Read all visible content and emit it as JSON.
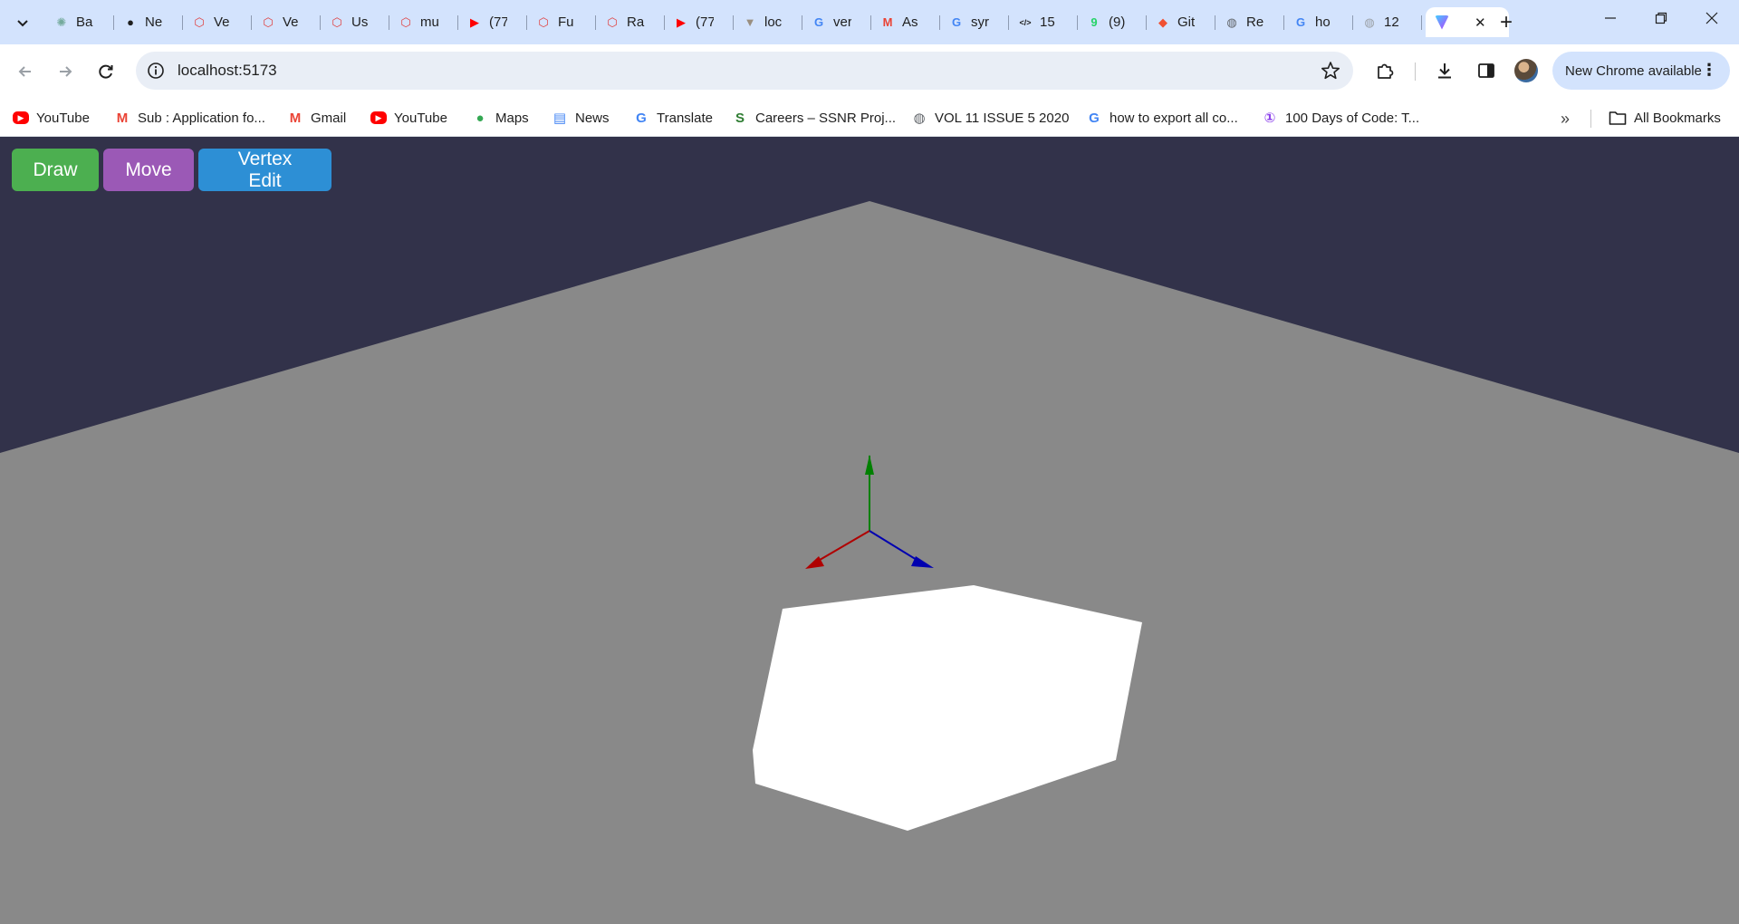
{
  "tabs": [
    {
      "title": "Ba",
      "icon": "chatgpt-icon",
      "color": "#74aa9c"
    },
    {
      "title": "Ne",
      "icon": "github-icon",
      "color": "#1f1f1f"
    },
    {
      "title": "Ve",
      "icon": "hexagon-icon",
      "color": "#e04040"
    },
    {
      "title": "Ve",
      "icon": "hexagon-icon",
      "color": "#e04040"
    },
    {
      "title": "Us",
      "icon": "hexagon-icon",
      "color": "#e04040"
    },
    {
      "title": "mu",
      "icon": "hexagon-icon",
      "color": "#e04040"
    },
    {
      "title": "(77",
      "icon": "youtube-icon",
      "color": "#ff0000"
    },
    {
      "title": "Fu",
      "icon": "hexagon-icon",
      "color": "#e04040"
    },
    {
      "title": "Ra",
      "icon": "hexagon-icon",
      "color": "#e04040"
    },
    {
      "title": "(77",
      "icon": "youtube-icon",
      "color": "#ff0000"
    },
    {
      "title": "loc",
      "icon": "funnel-icon",
      "color": "#9a8f80"
    },
    {
      "title": "ver",
      "icon": "google-icon",
      "color": "#4285f4"
    },
    {
      "title": "As",
      "icon": "gmail-icon",
      "color": "#ea4335"
    },
    {
      "title": "syr",
      "icon": "google-icon",
      "color": "#4285f4"
    },
    {
      "title": "15",
      "icon": "code-icon",
      "color": "#1f1f1f"
    },
    {
      "title": "(9)",
      "icon": "whatsapp-icon",
      "color": "#25d366"
    },
    {
      "title": "Git",
      "icon": "git-icon",
      "color": "#f05032"
    },
    {
      "title": "Re",
      "icon": "globe-icon",
      "color": "#5f6368"
    },
    {
      "title": "ho",
      "icon": "google-icon",
      "color": "#4285f4"
    },
    {
      "title": "12",
      "icon": "globe-icon",
      "color": "#9aa0a6"
    }
  ],
  "active_tab": {
    "icon": "vite-icon",
    "close": "✕"
  },
  "new_tab_label": "+",
  "address": {
    "url": "localhost:5173"
  },
  "update_chip": {
    "label": "New Chrome available",
    "menu": "⋮"
  },
  "bookmarks": [
    {
      "label": "YouTube",
      "icon": "youtube-icon",
      "color": "#ff0000",
      "glyph": "▶"
    },
    {
      "label": "Sub : Application fo...",
      "icon": "gmail-icon",
      "color": "#ea4335",
      "glyph": "M"
    },
    {
      "label": "Gmail",
      "icon": "gmail-icon",
      "color": "#ea4335",
      "glyph": "M"
    },
    {
      "label": "YouTube",
      "icon": "youtube-icon",
      "color": "#ff0000",
      "glyph": "▶"
    },
    {
      "label": "Maps",
      "icon": "maps-pin-icon",
      "color": "#34a853",
      "glyph": "●"
    },
    {
      "label": "News",
      "icon": "news-icon",
      "color": "#4285f4",
      "glyph": "▤"
    },
    {
      "label": "Translate",
      "icon": "translate-icon",
      "color": "#4285f4",
      "glyph": "G"
    },
    {
      "label": "Careers – SSNR Proj...",
      "icon": "ssnr-icon",
      "color": "#2e7d32",
      "glyph": "S"
    },
    {
      "label": "VOL 11 ISSUE 5 2020",
      "icon": "globe-icon",
      "color": "#5f6368",
      "glyph": "◍"
    },
    {
      "label": "how to export all co...",
      "icon": "google-icon",
      "color": "#4285f4",
      "glyph": "G"
    },
    {
      "label": "100 Days of Code: T...",
      "icon": "code-badge-icon",
      "color": "#8e44ec",
      "glyph": "①"
    }
  ],
  "bookmarks_more": "»",
  "all_bookmarks_label": "All Bookmarks",
  "toolbar_buttons": {
    "draw": "Draw",
    "move": "Move",
    "vertex_edit": "Vertex Edit"
  },
  "scene": {
    "background_color": "#32324a",
    "ground_color": "#898989",
    "shape_color": "#ffffff",
    "axis_colors": {
      "x": "#b00000",
      "y": "#008000",
      "z": "#0000b0"
    }
  }
}
